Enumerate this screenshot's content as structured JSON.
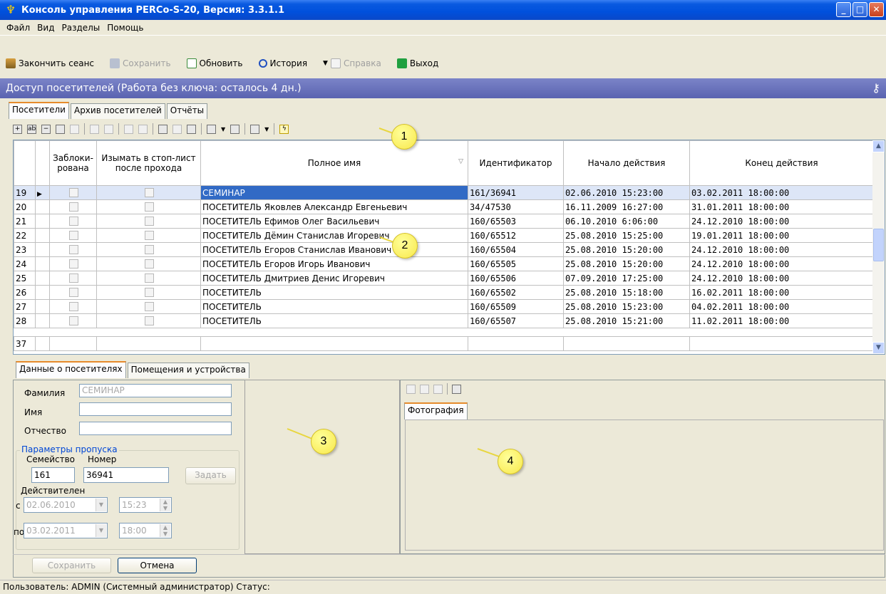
{
  "window": {
    "title": "Консоль управления PERCo-S-20, Версия: 3.3.1.1",
    "buttons": [
      "_",
      "□",
      "✕"
    ]
  },
  "menu": [
    "Файл",
    "Вид",
    "Разделы",
    "Помощь"
  ],
  "toolbar": {
    "end_session": "Закончить сеанс",
    "save": "Сохранить",
    "refresh": "Обновить",
    "history": "История",
    "help": "Справка",
    "exit": "Выход"
  },
  "section": {
    "title": "Доступ посетителей (Работа без ключа: осталось 4 дн.)"
  },
  "tabs": [
    "Посетители",
    "Архив посетителей",
    "Отчёты"
  ],
  "grid": {
    "headers": [
      "Заблоки-\nрована",
      "Изымать в стоп-лист\nпосле прохода",
      "Полное имя",
      "Идентификатор",
      "Начало действия",
      "Конец действия"
    ],
    "rows": [
      {
        "num": "19",
        "name": "СЕМИНАР",
        "id": "161/36941",
        "start": "02.06.2010 15:23:00",
        "end": "03.02.2011 18:00:00"
      },
      {
        "num": "20",
        "name": "ПОСЕТИТЕЛЬ Яковлев Александр Евгеньевич",
        "id": "34/47530",
        "start": "16.11.2009 16:27:00",
        "end": "31.01.2011 18:00:00"
      },
      {
        "num": "21",
        "name": "ПОСЕТИТЕЛЬ Ефимов Олег Васильевич",
        "id": "160/65503",
        "start": "06.10.2010 6:06:00",
        "end": "24.12.2010 18:00:00"
      },
      {
        "num": "22",
        "name": "ПОСЕТИТЕЛЬ Дёмин Станислав Игоревич",
        "id": "160/65512",
        "start": "25.08.2010 15:25:00",
        "end": "19.01.2011 18:00:00"
      },
      {
        "num": "23",
        "name": "ПОСЕТИТЕЛЬ  Егоров Станислав Иванович",
        "id": "160/65504",
        "start": "25.08.2010 15:20:00",
        "end": "24.12.2010 18:00:00"
      },
      {
        "num": "24",
        "name": "ПОСЕТИТЕЛЬ  Егоров Игорь Иванович",
        "id": "160/65505",
        "start": "25.08.2010 15:20:00",
        "end": "24.12.2010 18:00:00"
      },
      {
        "num": "25",
        "name": "ПОСЕТИТЕЛЬ  Дмитриев Денис Игоревич",
        "id": "160/65506",
        "start": "07.09.2010 17:25:00",
        "end": "24.12.2010 18:00:00"
      },
      {
        "num": "26",
        "name": "ПОСЕТИТЕЛЬ",
        "id": "160/65502",
        "start": "25.08.2010 15:18:00",
        "end": "16.02.2011 18:00:00"
      },
      {
        "num": "27",
        "name": "ПОСЕТИТЕЛЬ",
        "id": "160/65509",
        "start": "25.08.2010 15:23:00",
        "end": "04.02.2011 18:00:00"
      },
      {
        "num": "28",
        "name": "ПОСЕТИТЕЛЬ",
        "id": "160/65507",
        "start": "25.08.2010 15:21:00",
        "end": "11.02.2011 18:00:00"
      }
    ],
    "footer_num": "37"
  },
  "callouts": [
    "1",
    "2",
    "3",
    "4"
  ],
  "bottom_tabs": [
    "Данные о посетителях",
    "Помещения и устройства"
  ],
  "form": {
    "surname_label": "Фамилия",
    "surname_value": "СЕМИНАР",
    "name_label": "Имя",
    "patronymic_label": "Отчество",
    "pass_group": "Параметры пропуска",
    "family_label": "Семейство",
    "number_label": "Номер",
    "family_value": "161",
    "number_value": "36941",
    "set_button": "Задать",
    "valid_label": "Действителен",
    "from_label": "с",
    "from_date": "02.06.2010",
    "from_time": "15:23",
    "to_label": "по",
    "to_date": "03.02.2011",
    "to_time": "18:00",
    "save_button": "Сохранить",
    "cancel_button": "Отмена"
  },
  "photo": {
    "tab": "Фотография"
  },
  "status": {
    "text": "Пользователь:    ADMIN (Системный администратор) Статус:"
  }
}
